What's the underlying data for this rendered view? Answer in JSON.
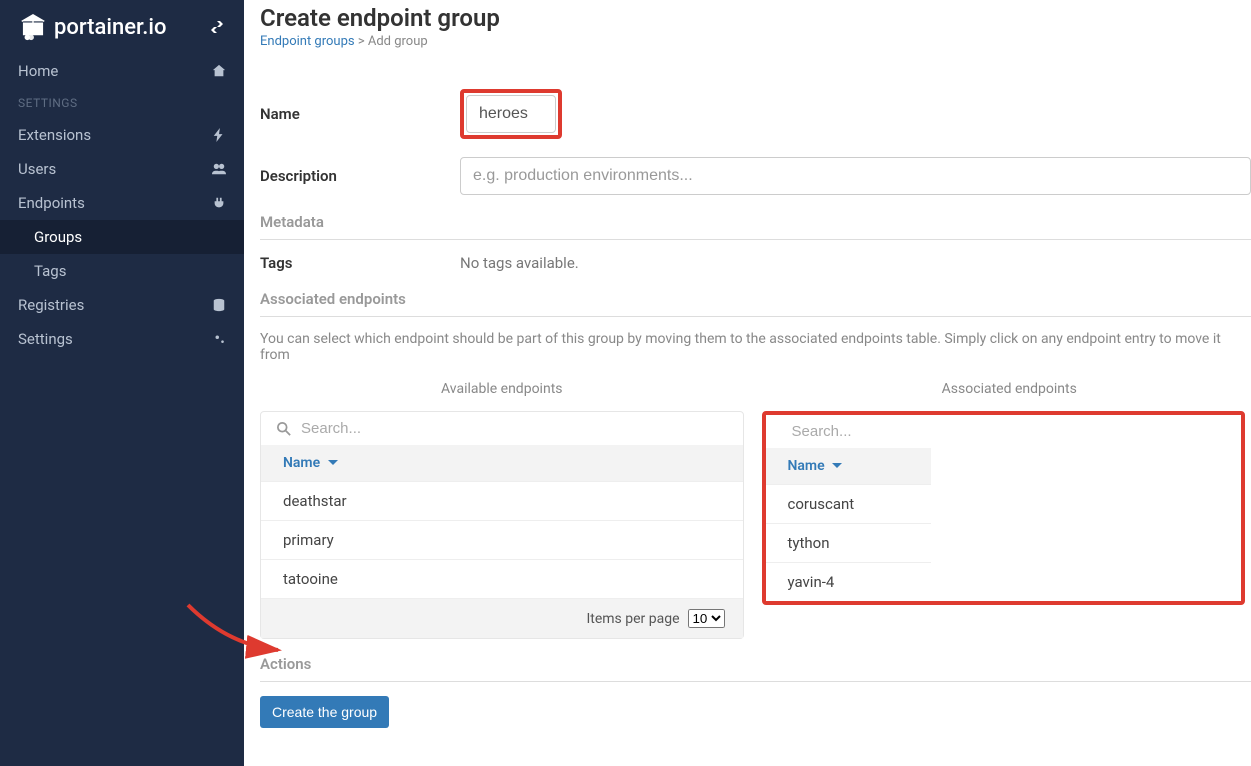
{
  "brand": "portainer.io",
  "sidebar": {
    "items": [
      {
        "label": "Home",
        "icon": "home"
      }
    ],
    "section_label": "SETTINGS",
    "settings": [
      {
        "label": "Extensions",
        "icon": "bolt"
      },
      {
        "label": "Users",
        "icon": "users"
      },
      {
        "label": "Endpoints",
        "icon": "plug"
      },
      {
        "label": "Groups",
        "sub": true,
        "active": true
      },
      {
        "label": "Tags",
        "sub": true
      },
      {
        "label": "Registries",
        "icon": "database"
      },
      {
        "label": "Settings",
        "icon": "cogs"
      }
    ]
  },
  "page": {
    "title": "Create endpoint group",
    "breadcrumb_link": "Endpoint groups",
    "breadcrumb_tail": " > Add group"
  },
  "form": {
    "name_label": "Name",
    "name_value": "heroes",
    "desc_label": "Description",
    "desc_placeholder": "e.g. production environments...",
    "metadata_title": "Metadata",
    "tags_label": "Tags",
    "tags_none": "No tags available.",
    "assoc_title": "Associated endpoints",
    "assoc_help": "You can select which endpoint should be part of this group by moving them to the associated endpoints table. Simply click on any endpoint entry to move it from",
    "available_title": "Available endpoints",
    "associated_title": "Associated endpoints",
    "search_placeholder": "Search...",
    "col_name": "Name",
    "available": [
      "deathstar",
      "primary",
      "tatooine"
    ],
    "associated": [
      "coruscant",
      "tython",
      "yavin-4"
    ],
    "items_per_page_label": "Items per page",
    "items_per_page_value": "10",
    "actions_title": "Actions",
    "create_button": "Create the group"
  }
}
